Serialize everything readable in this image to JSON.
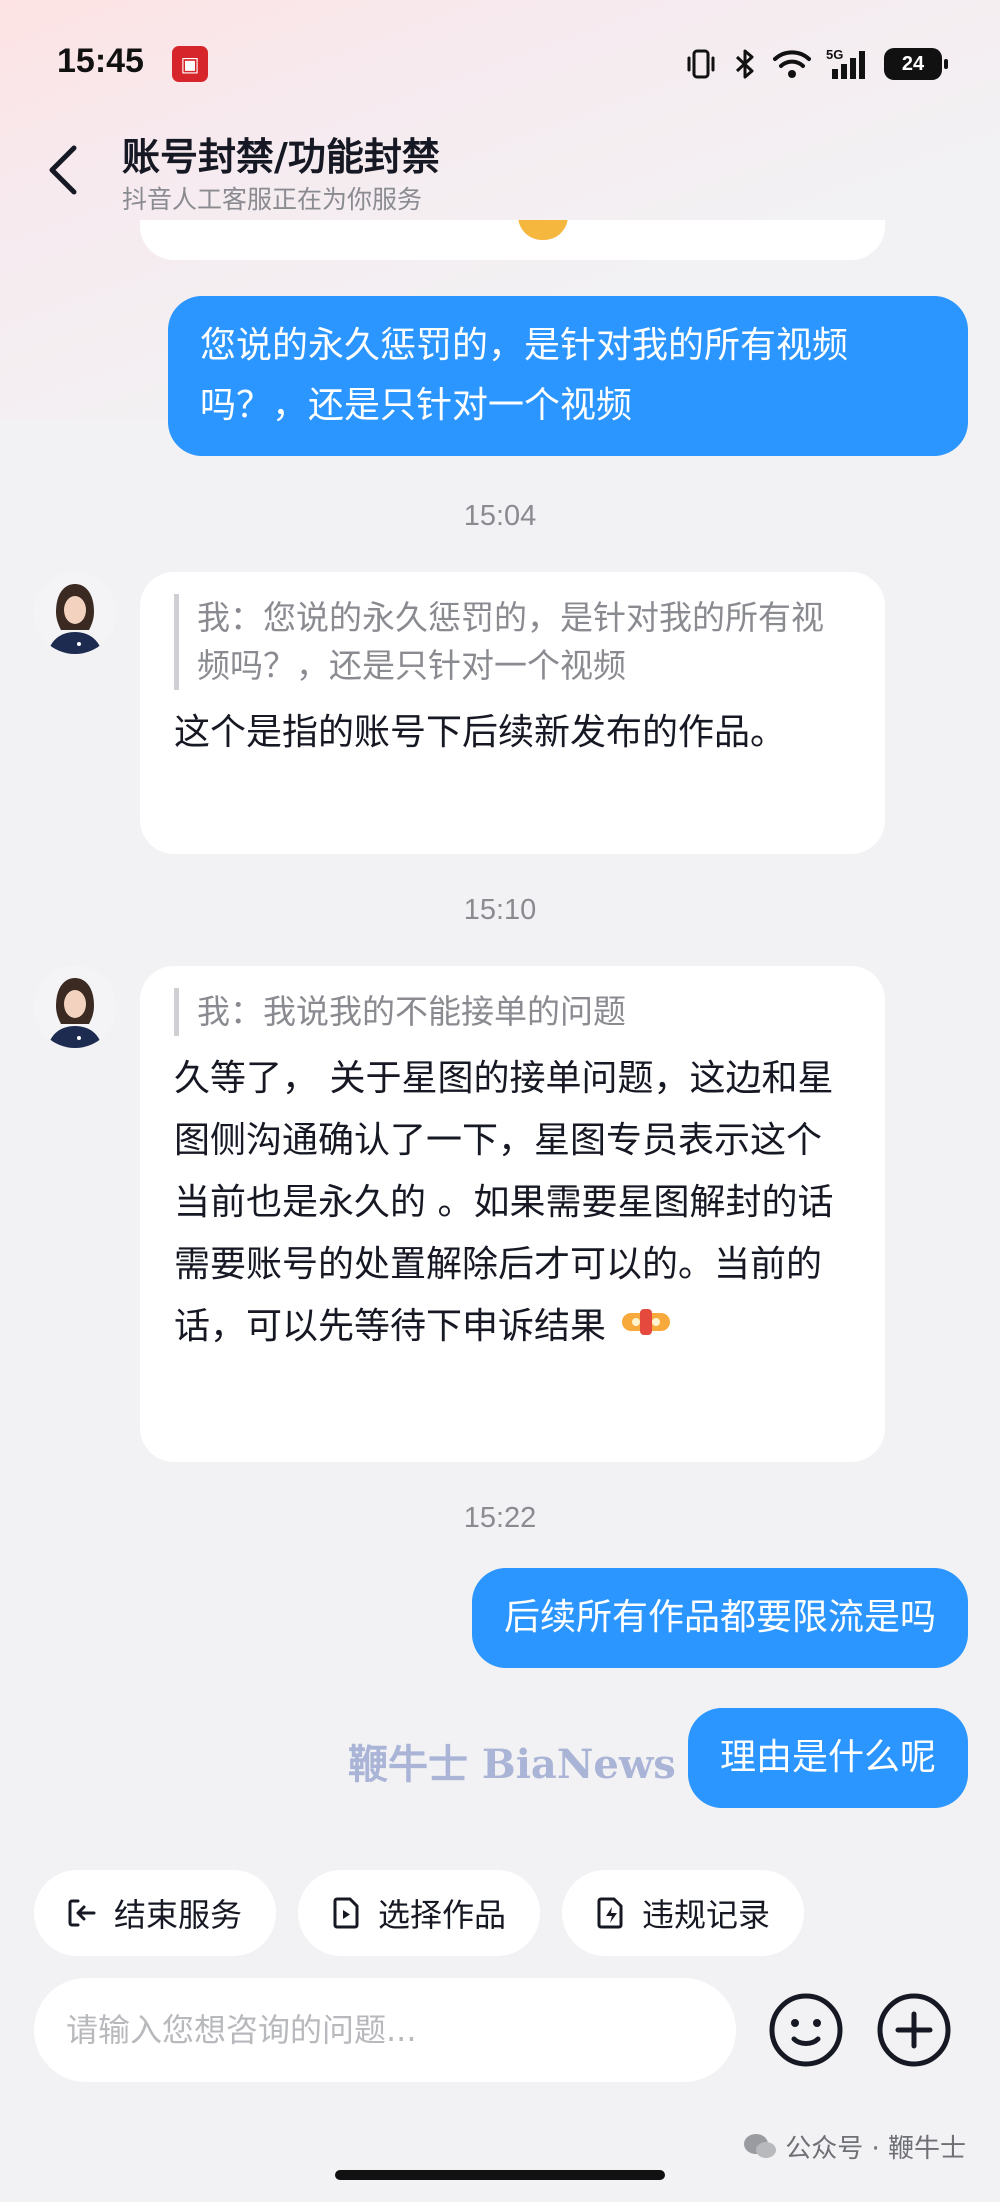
{
  "status_bar": {
    "time": "15:45",
    "battery": "24",
    "network": "5G"
  },
  "header": {
    "title": "账号封禁/功能封禁",
    "subtitle": "抖音人工客服正在为你服务"
  },
  "messages": [
    {
      "type": "user",
      "text": "您说的永久惩罚的，是针对我的所有视频吗？，还是只针对一个视频"
    },
    {
      "type": "timestamp",
      "text": "15:04"
    },
    {
      "type": "agent",
      "quote": "我：您说的永久惩罚的，是针对我的所有视频吗？，还是只针对一个视频",
      "text": "这个是指的账号下后续新发布的作品。"
    },
    {
      "type": "timestamp",
      "text": "15:10"
    },
    {
      "type": "agent",
      "quote": "我：我说我的不能接单的问题",
      "text": "久等了， 关于星图的接单问题，这边和星图侧沟通确认了一下，星图专员表示这个当前也是永久的 。如果需要星图解封的话 需要账号的处置解除后才可以的。当前的话，可以先等待下申诉结果"
    },
    {
      "type": "timestamp",
      "text": "15:22"
    },
    {
      "type": "user",
      "text": "后续所有作品都要限流是吗"
    },
    {
      "type": "user",
      "text": "理由是什么呢"
    }
  ],
  "watermark": "鞭牛士 BiaNews",
  "quick_actions": [
    {
      "label": "结束服务",
      "icon": "exit-icon"
    },
    {
      "label": "选择作品",
      "icon": "video-file-icon"
    },
    {
      "label": "违规记录",
      "icon": "violation-record-icon"
    }
  ],
  "input": {
    "placeholder": "请输入您想咨询的问题..."
  },
  "footer": {
    "account_mark": "公众号 · 鞭牛士"
  },
  "colors": {
    "user_bubble": "#2b96ff",
    "agent_bubble": "#ffffff",
    "background": "#f2f2f4"
  }
}
